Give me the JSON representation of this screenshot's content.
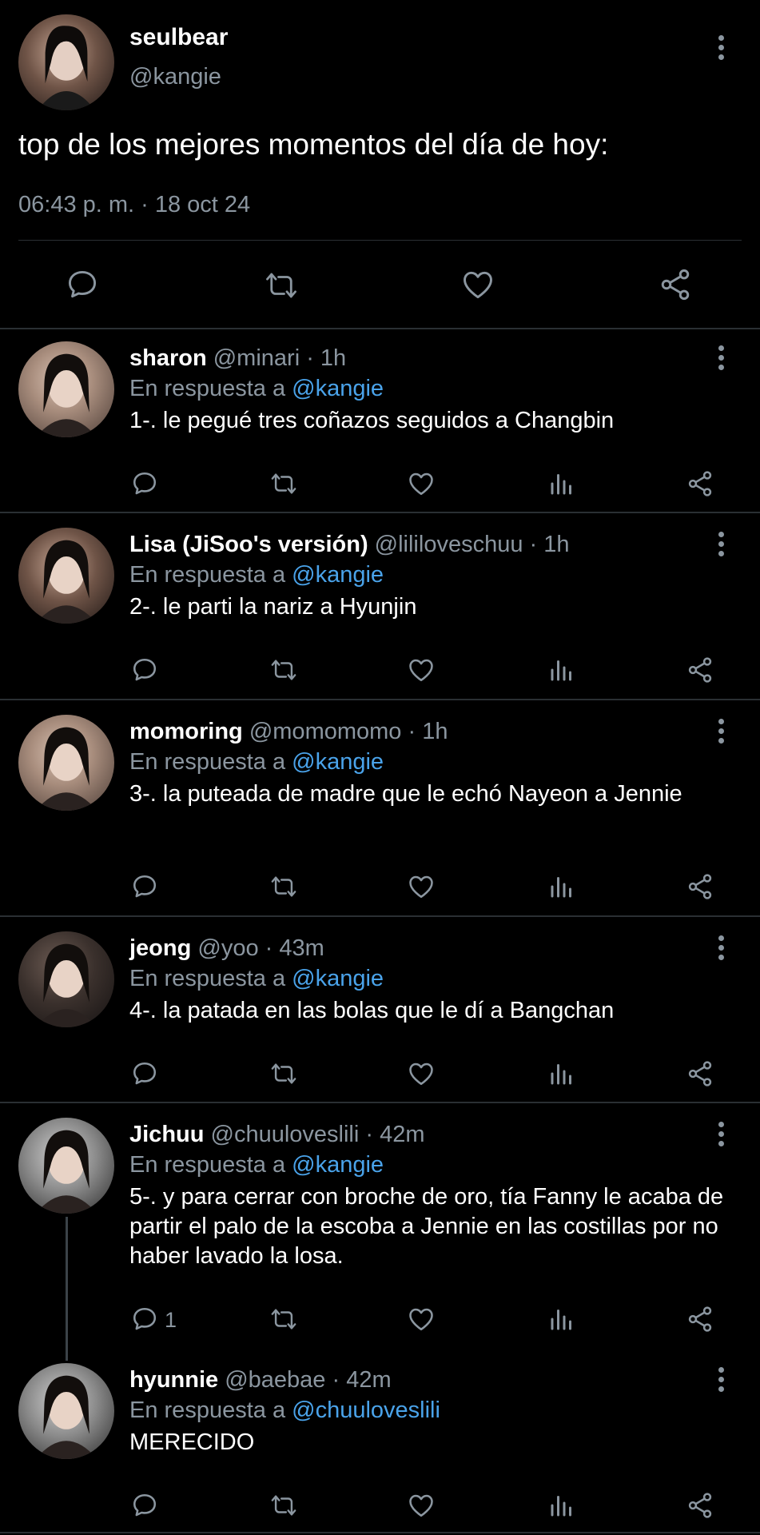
{
  "main_tweet": {
    "name": "seulbear",
    "handle": "@kangie",
    "text": "top de los mejores momentos del día de hoy:",
    "timestamp": "06:43 p. m. · 18 oct 24",
    "actions": [
      "comment-icon",
      "retweet-icon",
      "like-icon",
      "share-icon"
    ]
  },
  "replies": [
    {
      "name": "sharon",
      "meta": " @minari · 1h",
      "reply_prefix": "En respuesta a ",
      "reply_to": "@kangie",
      "text": "1-. le pegué tres coñazos seguidos a Changbin",
      "comment_count": ""
    },
    {
      "name": "Lisa (JiSoo's versión)",
      "meta": " @lililoveschuu · 1h",
      "reply_prefix": "En respuesta a ",
      "reply_to": "@kangie",
      "text": "2-. le parti la nariz a Hyunjin",
      "comment_count": ""
    },
    {
      "name": "momoring",
      "meta": " @momomomo · 1h",
      "reply_prefix": "En respuesta a ",
      "reply_to": "@kangie",
      "text": "3-. la puteada de madre que le echó Nayeon a Jennie",
      "comment_count": ""
    },
    {
      "name": "jeong",
      "meta": " @yoo · 43m",
      "reply_prefix": "En respuesta a ",
      "reply_to": "@kangie",
      "text": "4-. la patada en las bolas que le dí a Bangchan",
      "comment_count": ""
    },
    {
      "name": "Jichuu",
      "meta": " @chuuloveslili · 42m",
      "reply_prefix": "En respuesta a ",
      "reply_to": "@kangie",
      "text": "5-. y para cerrar con broche de oro, tía Fanny le acaba de partir el palo de la escoba a Jennie en las costillas por no haber lavado la losa.",
      "comment_count": "1"
    },
    {
      "name": "hyunnie",
      "meta": " @baebae · 42m",
      "reply_prefix": "En respuesta a ",
      "reply_to": "@chuuloveslili",
      "text": "MERECIDO",
      "comment_count": ""
    }
  ],
  "colors": {
    "background": "#000000",
    "muted": "#8b96a0",
    "mention": "#4aa3ea",
    "divider": "#2a2f33"
  }
}
